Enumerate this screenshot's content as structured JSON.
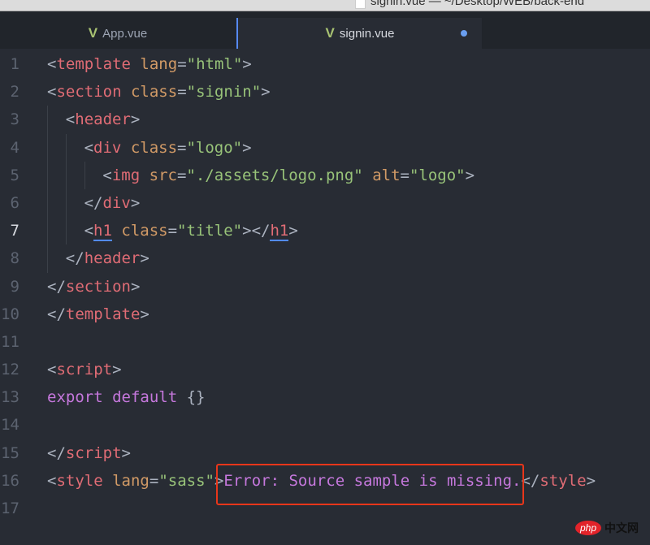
{
  "window": {
    "title": "signin.vue — ~/Desktop/WEB/back-end"
  },
  "tabs": [
    {
      "label": "App.vue",
      "icon": "vue-icon"
    },
    {
      "label": "signin.vue",
      "icon": "vue-icon",
      "modified": true
    }
  ],
  "current_line": 7,
  "lines": [
    {
      "n": "1",
      "indent": 0,
      "tokens": [
        [
          "<",
          "p"
        ],
        [
          "template",
          "tag"
        ],
        [
          " ",
          "p"
        ],
        [
          "lang",
          "attr"
        ],
        [
          "=",
          "p"
        ],
        [
          "\"html\"",
          "str"
        ],
        [
          ">",
          "p"
        ]
      ]
    },
    {
      "n": "2",
      "indent": 0,
      "tokens": [
        [
          "<",
          "p"
        ],
        [
          "section",
          "tag"
        ],
        [
          " ",
          "p"
        ],
        [
          "class",
          "attr"
        ],
        [
          "=",
          "p"
        ],
        [
          "\"signin\"",
          "str"
        ],
        [
          ">",
          "p"
        ]
      ]
    },
    {
      "n": "3",
      "indent": 1,
      "tokens": [
        [
          "<",
          "p"
        ],
        [
          "header",
          "tag"
        ],
        [
          ">",
          "p"
        ]
      ]
    },
    {
      "n": "4",
      "indent": 2,
      "tokens": [
        [
          "<",
          "p"
        ],
        [
          "div",
          "tag"
        ],
        [
          " ",
          "p"
        ],
        [
          "class",
          "attr"
        ],
        [
          "=",
          "p"
        ],
        [
          "\"logo\"",
          "str"
        ],
        [
          ">",
          "p"
        ]
      ]
    },
    {
      "n": "5",
      "indent": 3,
      "tokens": [
        [
          "<",
          "p"
        ],
        [
          "img",
          "tag"
        ],
        [
          " ",
          "p"
        ],
        [
          "src",
          "attr"
        ],
        [
          "=",
          "p"
        ],
        [
          "\"./assets/logo.png\"",
          "str"
        ],
        [
          " ",
          "p"
        ],
        [
          "alt",
          "attr"
        ],
        [
          "=",
          "p"
        ],
        [
          "\"logo\"",
          "str"
        ],
        [
          ">",
          "p"
        ]
      ]
    },
    {
      "n": "6",
      "indent": 2,
      "tokens": [
        [
          "</",
          "p"
        ],
        [
          "div",
          "tag"
        ],
        [
          ">",
          "p"
        ]
      ]
    },
    {
      "n": "7",
      "indent": 2,
      "tokens": [
        [
          "<",
          "p"
        ],
        [
          "h1",
          "tag ul"
        ],
        [
          " ",
          "p"
        ],
        [
          "class",
          "attr"
        ],
        [
          "=",
          "p"
        ],
        [
          "\"title\"",
          "str"
        ],
        [
          "></",
          "p"
        ],
        [
          "h1",
          "tag ul"
        ],
        [
          ">",
          "p"
        ]
      ]
    },
    {
      "n": "8",
      "indent": 1,
      "tokens": [
        [
          "</",
          "p"
        ],
        [
          "header",
          "tag"
        ],
        [
          ">",
          "p"
        ]
      ]
    },
    {
      "n": "9",
      "indent": 0,
      "tokens": [
        [
          "</",
          "p"
        ],
        [
          "section",
          "tag"
        ],
        [
          ">",
          "p"
        ]
      ]
    },
    {
      "n": "10",
      "indent": 0,
      "tokens": [
        [
          "</",
          "p"
        ],
        [
          "template",
          "tag"
        ],
        [
          ">",
          "p"
        ]
      ]
    },
    {
      "n": "11",
      "indent": 0,
      "tokens": []
    },
    {
      "n": "12",
      "indent": 0,
      "tokens": [
        [
          "<",
          "p"
        ],
        [
          "script",
          "tag"
        ],
        [
          ">",
          "p"
        ]
      ]
    },
    {
      "n": "13",
      "indent": 0,
      "tokens": [
        [
          "export",
          "kw"
        ],
        [
          " ",
          "p"
        ],
        [
          "default",
          "kw"
        ],
        [
          " {}",
          "p"
        ]
      ]
    },
    {
      "n": "14",
      "indent": 0,
      "tokens": []
    },
    {
      "n": "15",
      "indent": 0,
      "tokens": [
        [
          "</",
          "p"
        ],
        [
          "script",
          "tag"
        ],
        [
          ">",
          "p"
        ]
      ]
    },
    {
      "n": "16",
      "indent": 0,
      "tokens": [
        [
          "<",
          "p"
        ],
        [
          "style",
          "tag"
        ],
        [
          " ",
          "p"
        ],
        [
          "lang",
          "attr"
        ],
        [
          "=",
          "p"
        ],
        [
          "\"sass\"",
          "str"
        ],
        [
          ">",
          "p"
        ],
        [
          "Error: Source sample is missing.",
          "err"
        ],
        [
          "</",
          "p"
        ],
        [
          "style",
          "tag"
        ],
        [
          ">",
          "p"
        ]
      ]
    },
    {
      "n": "17",
      "indent": 0,
      "tokens": []
    }
  ],
  "watermark": {
    "brand": "php",
    "text": "中文网"
  }
}
